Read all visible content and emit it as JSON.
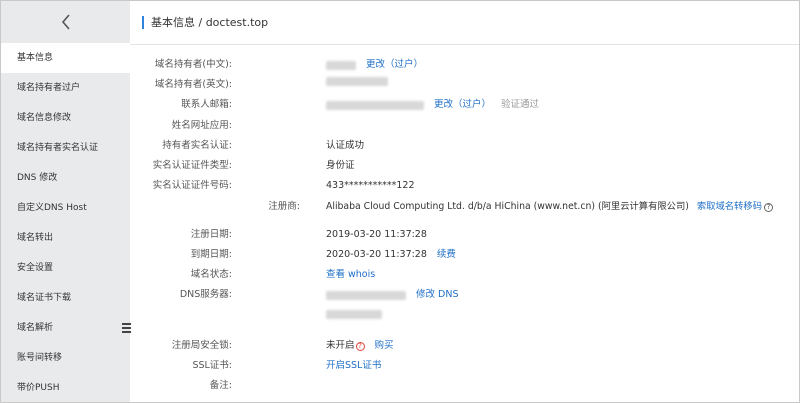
{
  "sidebar": {
    "items": [
      {
        "label": "基本信息",
        "active": true
      },
      {
        "label": "域名持有者过户"
      },
      {
        "label": "域名信息修改"
      },
      {
        "label": "域名持有者实名认证"
      },
      {
        "label": "DNS 修改"
      },
      {
        "label": "自定义DNS Host"
      },
      {
        "label": "域名转出"
      },
      {
        "label": "安全设置"
      },
      {
        "label": "域名证书下载"
      },
      {
        "label": "域名解析"
      },
      {
        "label": "账号间转移"
      },
      {
        "label": "带价PUSH"
      }
    ]
  },
  "breadcrumb": "基本信息 / doctest.top",
  "fields": {
    "owner_cn": {
      "label": "域名持有者(中文):",
      "action": "更改（过户）"
    },
    "owner_en": {
      "label": "域名持有者(英文):"
    },
    "email": {
      "label": "联系人邮箱:",
      "action": "更改（过户）",
      "status": "验证通过"
    },
    "alias": {
      "label": "姓名网址应用:"
    },
    "realname": {
      "label": "持有者实名认证:",
      "value": "认证成功"
    },
    "cert_type": {
      "label": "实名认证证件类型:",
      "value": "身份证"
    },
    "cert_no": {
      "label": "实名认证证件号码:",
      "value": "433***********122"
    },
    "registrar": {
      "label": "注册商:",
      "value": "Alibaba Cloud Computing Ltd. d/b/a HiChina (www.net.cn) (阿里云计算有限公司)",
      "action": "索取域名转移码"
    },
    "reg_date": {
      "label": "注册日期:",
      "value": "2019-03-20 11:37:28"
    },
    "exp_date": {
      "label": "到期日期:",
      "value": "2020-03-20 11:37:28",
      "action": "续费"
    },
    "status": {
      "label": "域名状态:",
      "action": "查看 whois"
    },
    "dns": {
      "label": "DNS服务器:",
      "action": "修改 DNS"
    },
    "lock": {
      "label": "注册局安全锁:",
      "value": "未开启",
      "action": "购买"
    },
    "ssl": {
      "label": "SSL证书:",
      "action": "开启SSL证书"
    },
    "note": {
      "label": "备注:"
    }
  },
  "icons": {
    "back": "chevron-left-icon",
    "help": "question-circle-icon",
    "warn": "warning-circle-icon",
    "toggle": "menu-toggle-icon"
  },
  "colors": {
    "accent": "#2f84db",
    "link": "#1f6fc7",
    "sidebar_bg": "#e9eaec"
  }
}
